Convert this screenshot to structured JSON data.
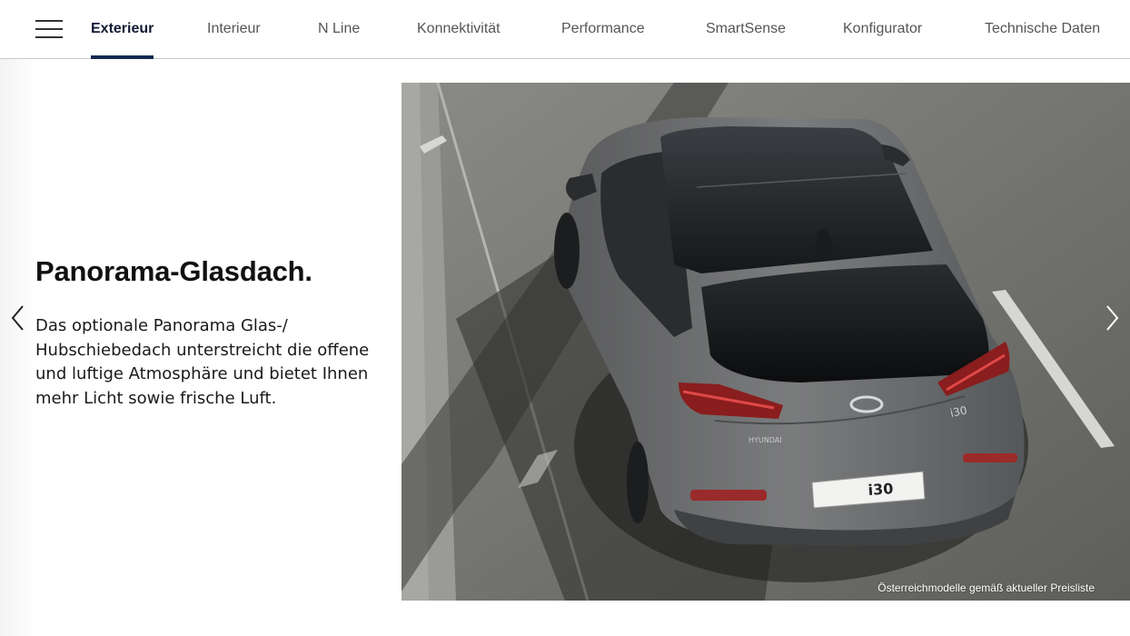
{
  "nav": {
    "menu_icon": "hamburger-menu-icon",
    "tabs": [
      {
        "label": "Exterieur",
        "active": true
      },
      {
        "label": "Interieur",
        "active": false
      },
      {
        "label": "N Line",
        "active": false
      },
      {
        "label": "Konnektivität",
        "active": false
      },
      {
        "label": "Performance",
        "active": false
      },
      {
        "label": "SmartSense",
        "active": false
      },
      {
        "label": "Konfigurator",
        "active": false
      },
      {
        "label": "Technische Daten",
        "active": false
      }
    ]
  },
  "feature": {
    "title": "Panorama-Glasdach.",
    "description": "Das optionale Panorama Glas-/ Hubschiebedach unterstreicht die offene und luftige Atmosphäre und bietet Ihnen mehr Licht sowie frische Luft."
  },
  "carousel": {
    "prev_icon": "chevron-left-icon",
    "next_icon": "chevron-right-icon"
  },
  "image": {
    "caption": "Österreichmodelle gemäß aktueller Preisliste",
    "badge_plate": "i30",
    "badge_model": "i30",
    "badge_brand": "HYUNDAI"
  },
  "colors": {
    "accent": "#0f2a4f",
    "active_tab_text": "#0f1a33",
    "inactive_tab_text": "#555555"
  }
}
